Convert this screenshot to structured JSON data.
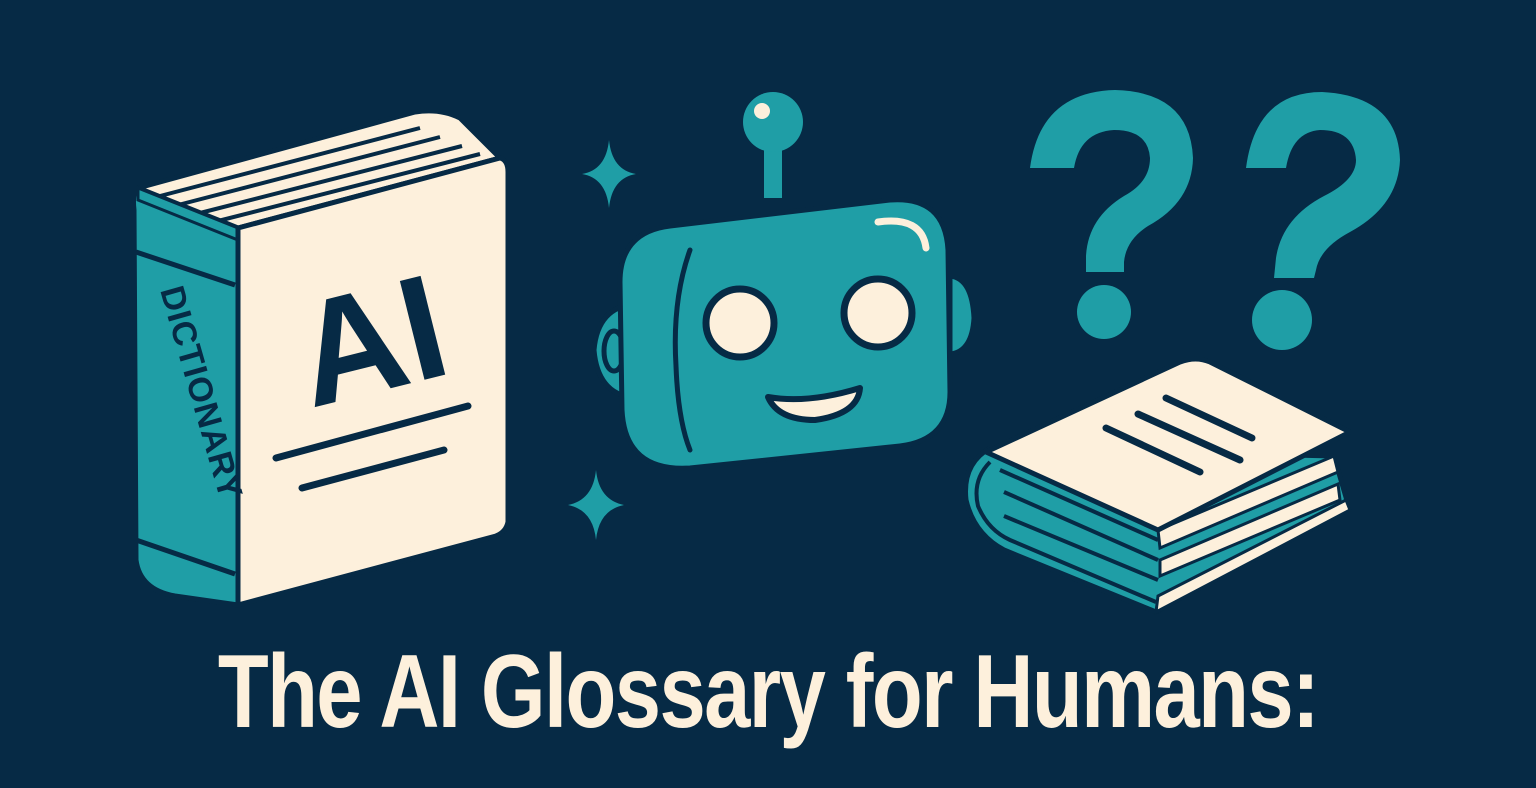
{
  "headline": "The AI Glossary for Humans:",
  "dictionary_book": {
    "cover_text": "AI",
    "spine_text": "DICTIONARY"
  },
  "question_marks": [
    "?",
    "?"
  ],
  "colors": {
    "background": "#062a45",
    "teal": "#1f9ea6",
    "cream": "#fdf0dc",
    "navy_outline": "#062a45"
  },
  "icons": [
    "dictionary-book-icon",
    "robot-head-icon",
    "sparkle-icon",
    "question-mark-icon",
    "closed-book-icon"
  ]
}
